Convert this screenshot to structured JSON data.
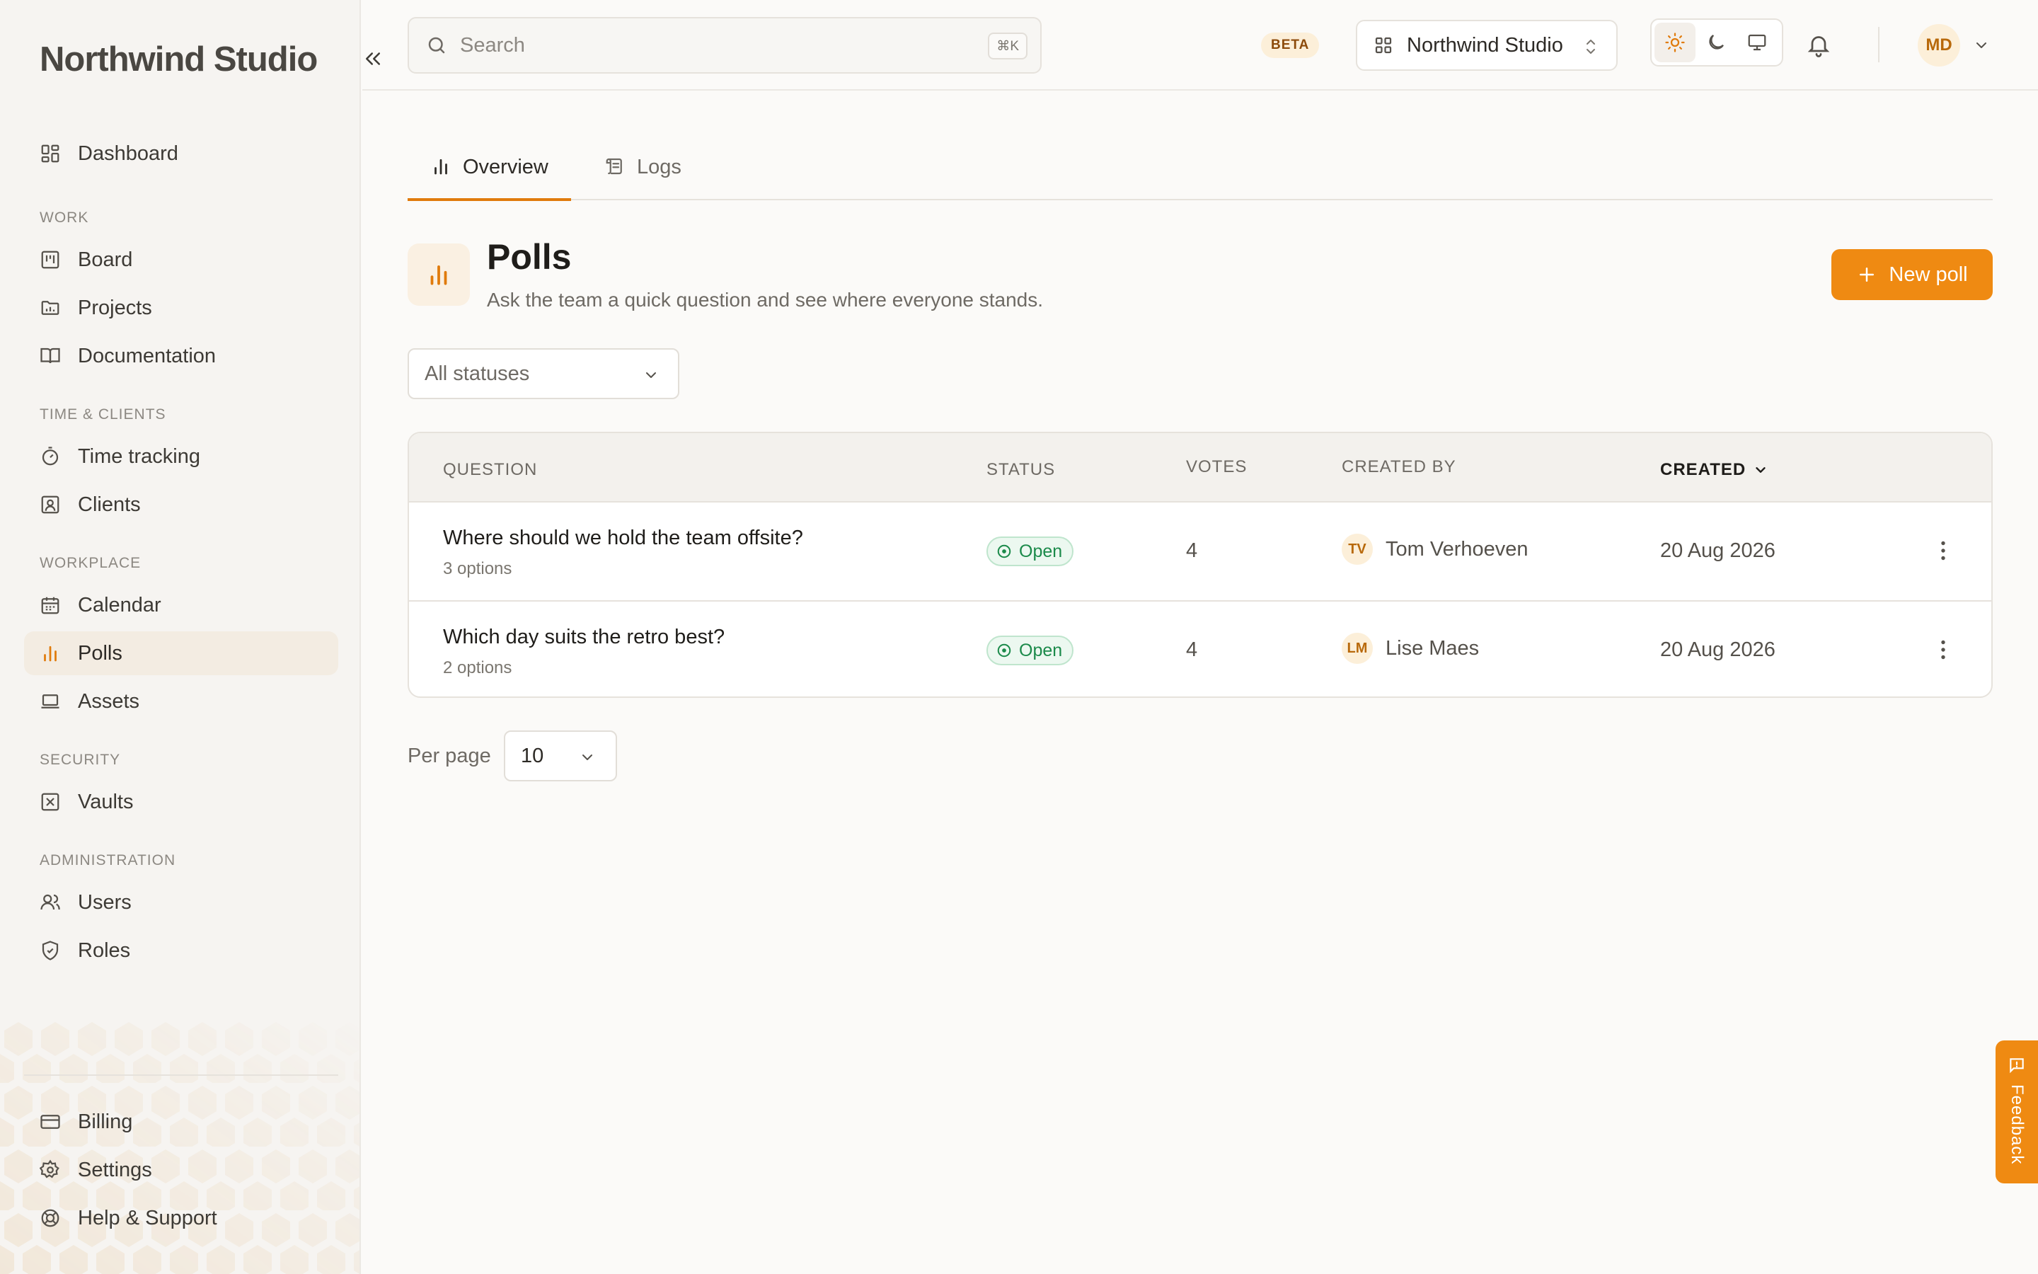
{
  "brand": "Northwind Studio",
  "sidebar": {
    "dashboard": "Dashboard",
    "sections": {
      "work": "WORK",
      "time_clients": "TIME & CLIENTS",
      "workplace": "WORKPLACE",
      "security": "SECURITY",
      "administration": "ADMINISTRATION"
    },
    "items": {
      "board": "Board",
      "projects": "Projects",
      "documentation": "Documentation",
      "time_tracking": "Time tracking",
      "clients": "Clients",
      "calendar": "Calendar",
      "polls": "Polls",
      "assets": "Assets",
      "vaults": "Vaults",
      "users": "Users",
      "roles": "Roles"
    },
    "footer": {
      "billing": "Billing",
      "settings": "Settings",
      "help": "Help & Support"
    },
    "active_item": "polls"
  },
  "topbar": {
    "search_placeholder": "Search",
    "search_shortcut": "⌘K",
    "beta": "BETA",
    "workspace": "Northwind Studio",
    "theme_active": "light",
    "user_initials": "MD"
  },
  "tabs": [
    {
      "label": "Overview",
      "icon": "bar-chart-icon",
      "active": true
    },
    {
      "label": "Logs",
      "icon": "scroll-icon",
      "active": false
    }
  ],
  "page": {
    "title": "Polls",
    "subtitle": "Ask the team a quick question and see where everyone stands.",
    "new_button": "New poll"
  },
  "filter": {
    "status_value": "All statuses"
  },
  "table": {
    "columns": {
      "question": "QUESTION",
      "status": "STATUS",
      "votes": "VOTES",
      "created_by": "CREATED BY",
      "created": "CREATED"
    },
    "sort": {
      "column": "created",
      "direction": "desc"
    },
    "rows": [
      {
        "question": "Where should we hold the team offsite?",
        "options": "3 options",
        "status": "Open",
        "votes": "4",
        "initials": "TV",
        "creator": "Tom Verhoeven",
        "created": "20 Aug 2026"
      },
      {
        "question": "Which day suits the retro best?",
        "options": "2 options",
        "status": "Open",
        "votes": "4",
        "initials": "LM",
        "creator": "Lise Maes",
        "created": "20 Aug 2026"
      }
    ]
  },
  "pagination": {
    "label": "Per page",
    "value": "10"
  },
  "feedback": "Feedback",
  "colors": {
    "accent": "#ef8a12",
    "status_open": "#1b8a4a",
    "avatar_bg": "#fcefd9"
  }
}
